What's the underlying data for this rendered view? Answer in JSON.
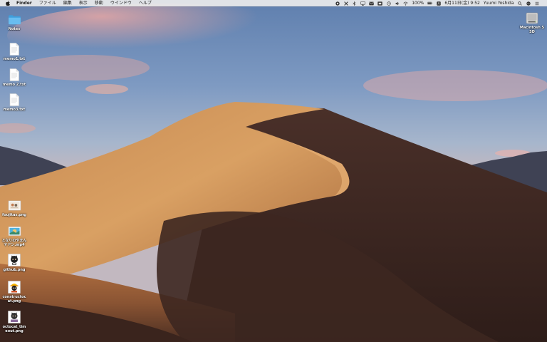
{
  "menubar": {
    "app_name": "Finder",
    "menus": [
      "ファイル",
      "編集",
      "表示",
      "移動",
      "ウインドウ",
      "ヘルプ"
    ],
    "battery": "100%",
    "date_time": "6月11日(金) 9:52",
    "user_name": "Yuumi Yoshida"
  },
  "desktop_left": [
    {
      "name": "Notes",
      "icon": "folder-icon"
    },
    {
      "name": "memo1.txt",
      "icon": "text-file-icon"
    },
    {
      "name": "memo 2.txt",
      "icon": "text-file-icon"
    },
    {
      "name": "memo3.txt",
      "icon": "text-file-icon"
    },
    {
      "name": "foujitas.png",
      "icon": "image-file-icon"
    },
    {
      "name": "となりのやまんヤドン.mp4",
      "icon": "video-file-icon"
    },
    {
      "name": "github.png",
      "icon": "image-file-icon"
    },
    {
      "name": "constructocat.png",
      "icon": "image-file-icon"
    },
    {
      "name": "octocat_timeout.png",
      "icon": "image-file-icon"
    }
  ],
  "desktop_right": [
    {
      "name": "Macintosh SSD",
      "icon": "hard-drive-icon"
    }
  ],
  "colors": {
    "menubar_bg": "#ececec",
    "folder": "#5fb4ea",
    "sand_light": "#d49a5a",
    "sand_dark": "#3a2620"
  }
}
